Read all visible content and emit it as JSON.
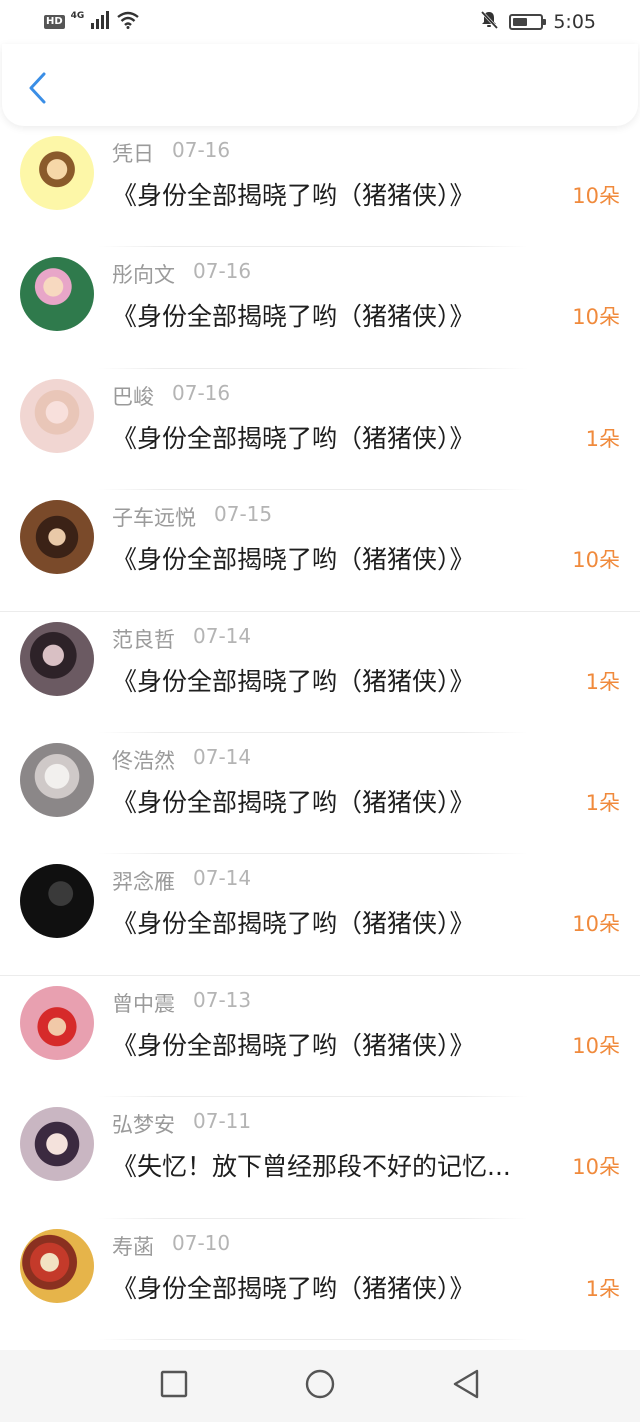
{
  "status_bar": {
    "hd": "HD",
    "network": "4G",
    "time": "5:05",
    "battery_level": 0.55
  },
  "header": {
    "back_icon": "chevron-left-icon",
    "accent_color": "#3a8ee6"
  },
  "colors": {
    "amount": "#f08a3c",
    "name": "#9a9a9a",
    "title": "#1e1e1e"
  },
  "rows": [
    {
      "name": "凭日",
      "date": "07-16",
      "title": "《身份全部揭晓了哟（猪猪侠）》",
      "amount": "10朵",
      "avatar": "cartoon-girl-avatar"
    },
    {
      "name": "彤向文",
      "date": "07-16",
      "title": "《身份全部揭晓了哟（猪猪侠）》",
      "amount": "10朵",
      "avatar": "anime-girl-avatar"
    },
    {
      "name": "巴峻",
      "date": "07-16",
      "title": "《身份全部揭晓了哟（猪猪侠）》",
      "amount": "1朵",
      "avatar": "anime-girl-pink-avatar"
    },
    {
      "name": "子车远悦",
      "date": "07-15",
      "title": "《身份全部揭晓了哟（猪猪侠）》",
      "amount": "10朵",
      "avatar": "anime-boy-avatar"
    },
    {
      "name": "范良哲",
      "date": "07-14",
      "title": "《身份全部揭晓了哟（猪猪侠）》",
      "amount": "1朵",
      "avatar": "photo-girl-avatar"
    },
    {
      "name": "佟浩然",
      "date": "07-14",
      "title": "《身份全部揭晓了哟（猪猪侠）》",
      "amount": "1朵",
      "avatar": "anime-white-hair-avatar"
    },
    {
      "name": "羿念雁",
      "date": "07-14",
      "title": "《身份全部揭晓了哟（猪猪侠）》",
      "amount": "10朵",
      "avatar": "dark-silhouette-avatar"
    },
    {
      "name": "曾中震",
      "date": "07-13",
      "title": "《身份全部揭晓了哟（猪猪侠）》",
      "amount": "10朵",
      "avatar": "red-hat-boy-avatar"
    },
    {
      "name": "弘梦安",
      "date": "07-11",
      "title": "《失忆！放下曾经那段不好的记忆...",
      "amount": "10朵",
      "avatar": "anime-smile-avatar"
    },
    {
      "name": "寿菡",
      "date": "07-10",
      "title": "《身份全部揭晓了哟（猪猪侠）》",
      "amount": "1朵",
      "avatar": "colorful-art-avatar"
    }
  ],
  "nav_bar": {
    "recent_icon": "square-icon",
    "home_icon": "circle-icon",
    "back_icon": "triangle-back-icon"
  }
}
